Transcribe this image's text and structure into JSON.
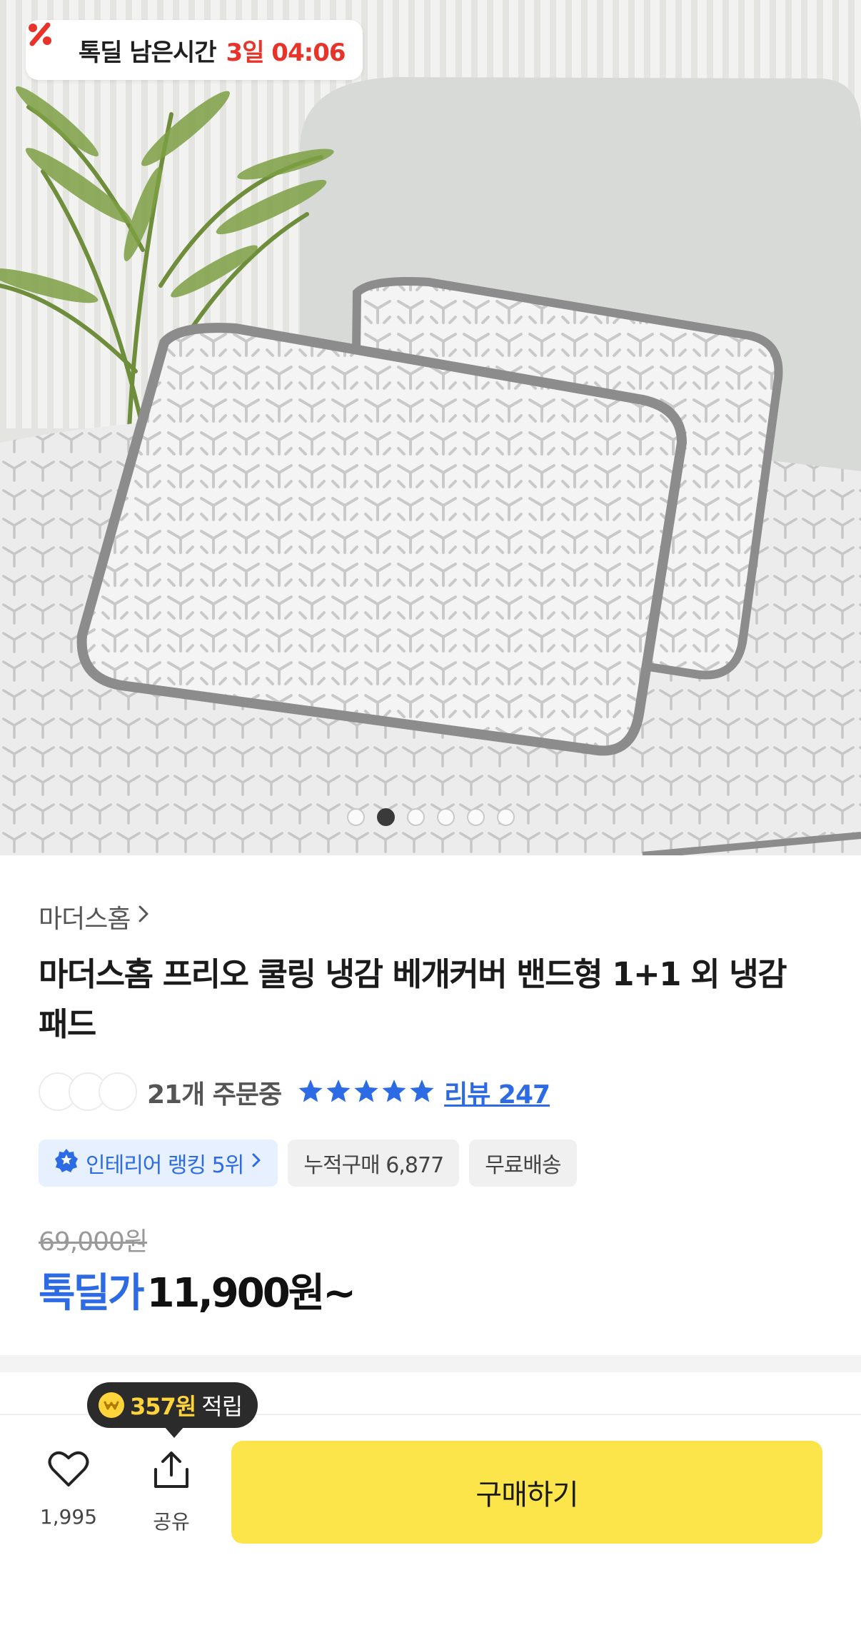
{
  "deal_timer": {
    "label": "톡딜 남은시간",
    "remaining": "3일 04:06",
    "icon": "percent-icon",
    "accent_color": "#e8332a"
  },
  "gallery": {
    "image_alt": "cooling pillow covers on a cooling pad",
    "total_slides": 6,
    "active_slide": 2
  },
  "product": {
    "brand": "마더스홈",
    "title": "마더스홈 프리오 쿨링 냉감 베개커버 밴드형 1+1 외 냉감패드",
    "orders_text": "21개 주문중",
    "rating_stars": 5,
    "review_label": "리뷰 247",
    "chips": {
      "ranking": "인테리어 랭킹 5위",
      "cumulative": "누적구매 6,877",
      "shipping": "무료배송"
    },
    "original_price": "69,000원",
    "deal_label": "톡딜가",
    "deal_price": "11,900원~"
  },
  "bottom_bar": {
    "reward_amount": "357원",
    "reward_suffix": "적립",
    "like_count": "1,995",
    "share_label": "공유",
    "buy_label": "구매하기",
    "buy_color": "#fce54a"
  },
  "colors": {
    "link_blue": "#2d6be4",
    "star_blue": "#2d6be4"
  }
}
